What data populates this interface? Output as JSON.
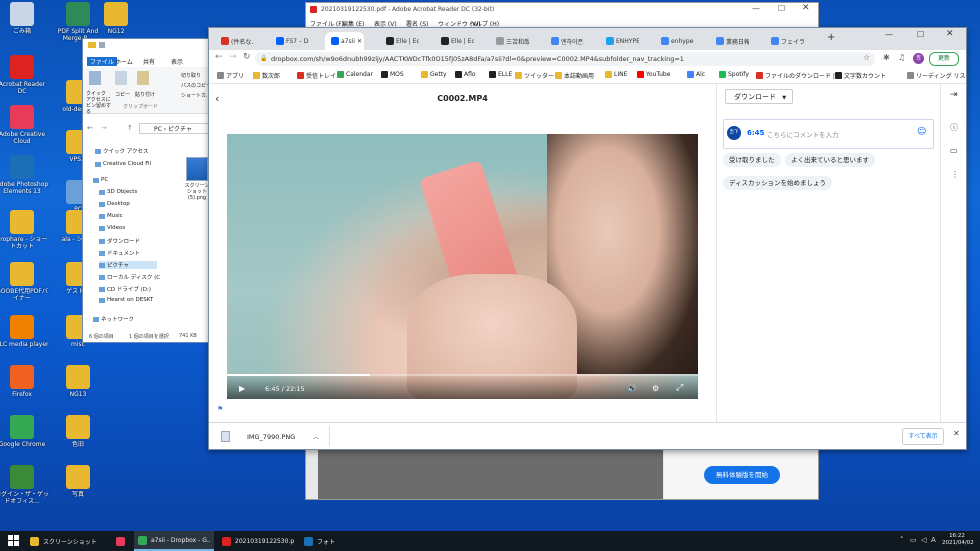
{
  "desktop": {
    "icons": [
      {
        "label": "ごみ箱",
        "color": "#c8d6e5"
      },
      {
        "label": "PDF Split And Merge B...",
        "color": "#2e8b57"
      },
      {
        "label": "NG12",
        "color": "#e8b830"
      },
      {
        "label": "Acrobat Reader DC",
        "color": "#d22"
      },
      {
        "label": "old-desk...",
        "color": "#e8b830"
      },
      {
        "label": "Adobe Creative Cloud",
        "color": "#e83a5a"
      },
      {
        "label": "VPS...",
        "color": "#e8b830"
      },
      {
        "label": "Adobe Photoshop Elements 13",
        "color": "#1a6fb5"
      },
      {
        "label": "PC",
        "color": "#6aa0d8"
      },
      {
        "label": "drophare - ショートカット",
        "color": "#e8b830"
      },
      {
        "label": "ala - ショ...",
        "color": "#e8b830"
      },
      {
        "label": "GOOBE代用PDFバイナー",
        "color": "#e8b830"
      },
      {
        "label": "ゲスト...",
        "color": "#e8b830"
      },
      {
        "label": "VLC media player",
        "color": "#f08000"
      },
      {
        "label": "misc",
        "color": "#e8b830"
      },
      {
        "label": "Firefox",
        "color": "#f06020"
      },
      {
        "label": "NG13",
        "color": "#e8b830"
      },
      {
        "label": "Google Chrome",
        "color": "#34a853"
      },
      {
        "label": "色旧",
        "color": "#e8b830"
      },
      {
        "label": "ログイン・ザ・ゲッドオフィス...",
        "color": "#3a8a3a"
      },
      {
        "label": "写真",
        "color": "#e8b830"
      }
    ]
  },
  "explorer": {
    "ribbon_tabs": [
      "ファイル",
      "ホーム",
      "共有",
      "表示"
    ],
    "ribbon_cmds": [
      "クイック アクセスにピン留めする",
      "コピー",
      "貼り付け",
      "切り取り",
      "パスのコピー",
      "ショートカ..."
    ],
    "ribbon_group": "クリップボード",
    "address": "PC › ピクチャ",
    "nav": [
      "クイック アクセス",
      "Creative Cloud Fil",
      "PC",
      "3D Objects",
      "Desktop",
      "Music",
      "Videos",
      "ダウンロード",
      "ドキュメント",
      "ピクチャ",
      "ローカル ディスク (C",
      "CD ドライブ (D:)",
      "Hearst on DESKT",
      "ネットワーク"
    ],
    "file_label": "スクリーンショット (5).png",
    "status_count": "6 個の項目",
    "status_selected": "1 個の項目を選択",
    "status_size": "741 KB"
  },
  "acrobat": {
    "title": "20210319122530.pdf - Adobe Acrobat Reader DC (32-bit)",
    "menu": [
      "ファイル (F)",
      "編集 (E)",
      "表示 (V)",
      "署名 (S)",
      "ウィンドウ (W)",
      "ヘルプ (H)"
    ],
    "cta": "無料体験版を開始",
    "cta_color": "#1473e6"
  },
  "chrome": {
    "tabs": [
      {
        "label": "(件名な...",
        "color": "#d93025"
      },
      {
        "label": "FS7 – Dr...",
        "color": "#0061fe"
      },
      {
        "label": "a7sii",
        "color": "#0061fe"
      },
      {
        "label": "Elle | Edi...",
        "color": "#222"
      },
      {
        "label": "Elle | Edi...",
        "color": "#222"
      },
      {
        "label": "三苫和哉...",
        "color": "#999"
      },
      {
        "label": "엔하이픈...",
        "color": "#4285f4"
      },
      {
        "label": "ENHYPEN...",
        "color": "#1da1f2"
      },
      {
        "label": "enhypen...",
        "color": "#4285f4"
      },
      {
        "label": "業務日報...",
        "color": "#4285f4"
      },
      {
        "label": "フェイラー...",
        "color": "#4285f4"
      }
    ],
    "url": "dropbox.com/sh/w9o6dnubh99zijy/AACTKWDcTfk0O15fj05zA8dFa/a7sii?dl=0&preview=C0002.MP4&subfolder_nav_tracking=1",
    "profile_initial": "吉",
    "update_label": "更新",
    "bookmarks": [
      {
        "label": "アプリ",
        "color": "#888"
      },
      {
        "label": "数次郎",
        "color": "#e8b830"
      },
      {
        "label": "受信トレイ",
        "color": "#d93025"
      },
      {
        "label": "Calendar",
        "color": "#34a853"
      },
      {
        "label": "MOS",
        "color": "#222"
      },
      {
        "label": "Getty",
        "color": "#e8b830"
      },
      {
        "label": "Aflo",
        "color": "#222"
      },
      {
        "label": "ELLE",
        "color": "#222"
      },
      {
        "label": "ツイッター",
        "color": "#e8b830"
      },
      {
        "label": "本誌動画用",
        "color": "#e8b830"
      },
      {
        "label": "LINE",
        "color": "#e8b830"
      },
      {
        "label": "YouTube",
        "color": "#ff0000"
      },
      {
        "label": "Alc",
        "color": "#4285f4"
      },
      {
        "label": "Spotify",
        "color": "#1db954"
      },
      {
        "label": "ファイルのダウンロード | ...",
        "color": "#d93025"
      },
      {
        "label": "文字数カウント",
        "color": "#222"
      },
      {
        "label": "リーディング リスト",
        "color": "#888"
      }
    ]
  },
  "dropbox": {
    "file_title": "C0002.MP4",
    "download_label": "ダウンロード",
    "current_time": "6:45",
    "duration": "22:15",
    "progress": 0.303,
    "avatar_text": "吉下",
    "comment_time": "6:45",
    "comment_placeholder": "· こちらにコメントを入力",
    "suggestions": [
      "受け取りました",
      "よく出来ていると思います",
      "ディスカッションを始めましょう"
    ],
    "accent": "#0061fe"
  },
  "downloads_bar": {
    "file": "IMG_7990.PNG",
    "show_all": "すべて表示"
  },
  "taskbar": {
    "items": [
      {
        "label": "スクリーンショット",
        "color": "#e8b830",
        "active": false
      },
      {
        "label": "",
        "color": "#e83a5a",
        "active": false
      },
      {
        "label": "a7sii - Dropbox - G...",
        "color": "#34a853",
        "active": true
      },
      {
        "label": "20210319122530.pd...",
        "color": "#d22",
        "active": false
      },
      {
        "label": "フォト",
        "color": "#1a6fb5",
        "active": false
      }
    ],
    "time": "16:22",
    "date": "2021/04/02",
    "ime": "A"
  }
}
